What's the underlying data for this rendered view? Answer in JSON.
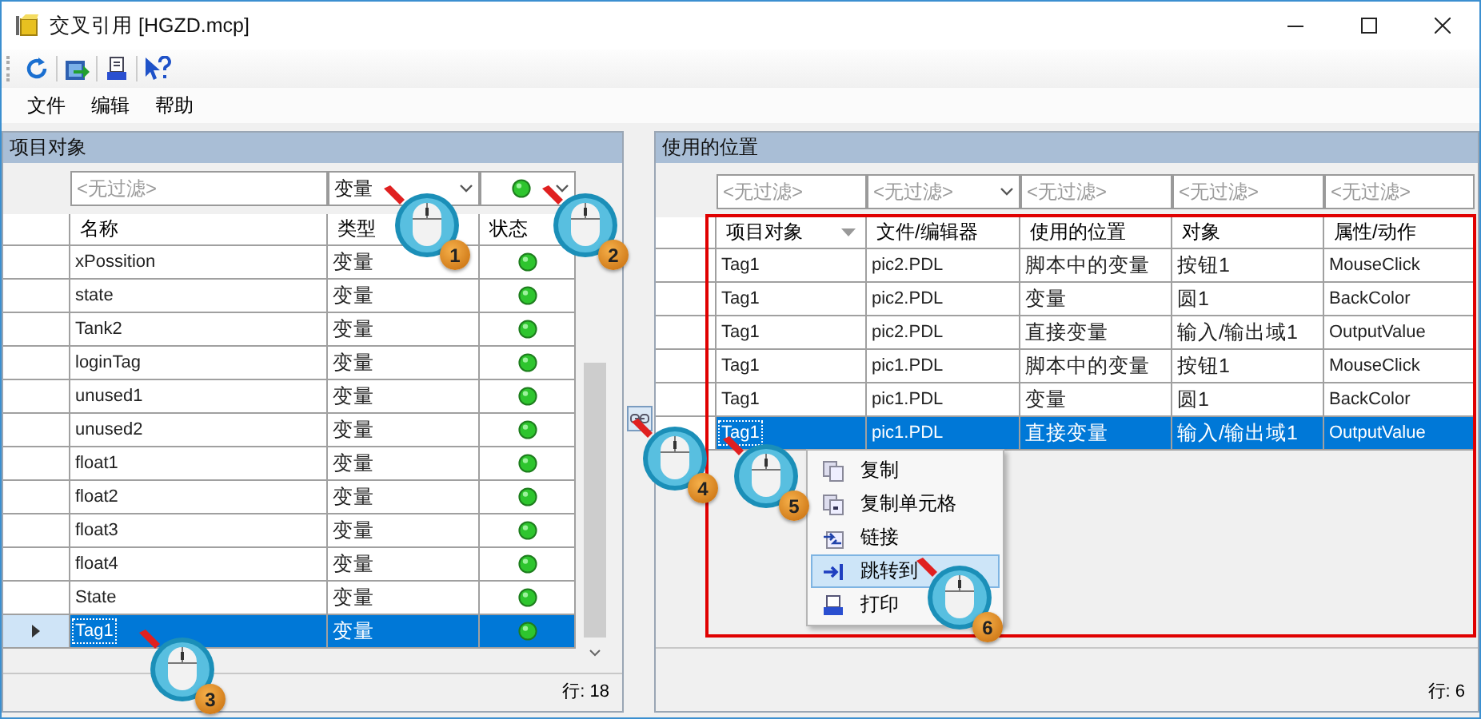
{
  "window": {
    "title": "交叉引用 [HGZD.mcp]"
  },
  "menu": [
    {
      "label": "文件"
    },
    {
      "label": "编辑"
    },
    {
      "label": "帮助"
    }
  ],
  "left_panel": {
    "title": "项目对象",
    "filters": [
      {
        "kind": "text",
        "placeholder": "<无过滤>"
      },
      {
        "kind": "combo",
        "value": "变量"
      },
      {
        "kind": "status"
      }
    ],
    "columns": [
      {
        "label": "名称",
        "sorted": false
      },
      {
        "label": "类型",
        "sorted": false
      },
      {
        "label": "状态",
        "sorted": false
      }
    ],
    "rows": [
      {
        "name": "xPossition",
        "type": "变量",
        "selected": false
      },
      {
        "name": "state",
        "type": "变量",
        "selected": false
      },
      {
        "name": "Tank2",
        "type": "变量",
        "selected": false
      },
      {
        "name": "loginTag",
        "type": "变量",
        "selected": false
      },
      {
        "name": "unused1",
        "type": "变量",
        "selected": false
      },
      {
        "name": "unused2",
        "type": "变量",
        "selected": false
      },
      {
        "name": "float1",
        "type": "变量",
        "selected": false
      },
      {
        "name": "float2",
        "type": "变量",
        "selected": false
      },
      {
        "name": "float3",
        "type": "变量",
        "selected": false
      },
      {
        "name": "float4",
        "type": "变量",
        "selected": false
      },
      {
        "name": "State",
        "type": "变量",
        "selected": false
      },
      {
        "name": "Tag1",
        "type": "变量",
        "selected": true
      }
    ],
    "row_count": "行: 18"
  },
  "right_panel": {
    "title": "使用的位置",
    "filters": [
      {
        "kind": "text",
        "placeholder": "<无过滤>"
      },
      {
        "kind": "combo",
        "placeholder": "<无过滤>"
      },
      {
        "kind": "text",
        "placeholder": "<无过滤>"
      },
      {
        "kind": "text",
        "placeholder": "<无过滤>"
      },
      {
        "kind": "text",
        "placeholder": "<无过滤>"
      }
    ],
    "columns": [
      {
        "label": "项目对象",
        "sorted": true
      },
      {
        "label": "文件/编辑器",
        "sorted": false
      },
      {
        "label": "使用的位置",
        "sorted": false
      },
      {
        "label": "对象",
        "sorted": false
      },
      {
        "label": "属性/动作",
        "sorted": false
      }
    ],
    "rows": [
      {
        "cells": [
          "Tag1",
          "pic2.PDL",
          "脚本中的变量",
          "按钮1",
          "MouseClick"
        ],
        "selected": false
      },
      {
        "cells": [
          "Tag1",
          "pic2.PDL",
          "变量",
          "圆1",
          "BackColor"
        ],
        "selected": false
      },
      {
        "cells": [
          "Tag1",
          "pic2.PDL",
          "直接变量",
          "输入/输出域1",
          "OutputValue"
        ],
        "selected": false
      },
      {
        "cells": [
          "Tag1",
          "pic1.PDL",
          "脚本中的变量",
          "按钮1",
          "MouseClick"
        ],
        "selected": false
      },
      {
        "cells": [
          "Tag1",
          "pic1.PDL",
          "变量",
          "圆1",
          "BackColor"
        ],
        "selected": false
      },
      {
        "cells": [
          "Tag1",
          "pic1.PDL",
          "直接变量",
          "输入/输出域1",
          "OutputValue"
        ],
        "selected": true
      }
    ],
    "row_count": "行: 6"
  },
  "context_menu": [
    {
      "label": "复制",
      "selected": false
    },
    {
      "label": "复制单元格",
      "selected": false
    },
    {
      "label": "链接",
      "selected": false
    },
    {
      "label": "跳转到",
      "selected": true
    },
    {
      "label": "打印",
      "selected": false
    }
  ],
  "steps": [
    {
      "number": "1"
    },
    {
      "number": "2"
    },
    {
      "number": "3"
    },
    {
      "number": "4"
    },
    {
      "number": "5"
    },
    {
      "number": "6"
    }
  ]
}
